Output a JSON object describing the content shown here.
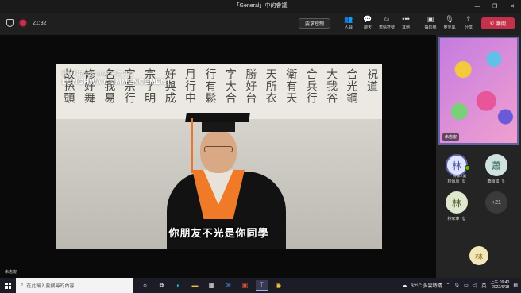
{
  "window": {
    "title": "「General」中的會議",
    "minimize": "—",
    "maximize": "❐",
    "close": "✕"
  },
  "toolbar": {
    "timer": "21:32",
    "request_control": "要求控制",
    "left_items": [
      {
        "label": "人員",
        "icon": "people-icon",
        "glyph": "👥"
      },
      {
        "label": "聊天",
        "icon": "chat-icon",
        "glyph": "💬"
      },
      {
        "label": "表情符號",
        "icon": "reaction-icon",
        "glyph": "☺"
      },
      {
        "label": "其他",
        "icon": "more-icon",
        "glyph": "•••"
      }
    ],
    "right_items": [
      {
        "label": "攝影機",
        "icon": "camera-off-icon",
        "glyph": "▣"
      },
      {
        "label": "麥克風",
        "icon": "mic-off-icon",
        "glyph": "🎙"
      },
      {
        "label": "分享",
        "icon": "share-icon",
        "glyph": "⇪"
      }
    ],
    "leave": "離開",
    "leave_color": "#c4314b"
  },
  "stage": {
    "logo_line1": "龍華科技大學 2022 畢業典禮",
    "logo_line2": "LUNGHWA COMMENCEMENT",
    "subtitle": "你朋友不光是你同學",
    "presenter_name": "朱志宏",
    "calligraphy": [
      "故孫頭",
      "修好舞",
      "名我易",
      "字宗行",
      "宗字明",
      "好與成",
      "月行中",
      "行有鬆",
      "字大合",
      "勝好台",
      "天所衣",
      "衛有天",
      "合兵行",
      "大我谷",
      "合光鋼",
      "祝道"
    ]
  },
  "sidebar": {
    "self_name": "朱志宏",
    "participants": [
      {
        "name": "林佩周",
        "initial": "林",
        "bg": "#dfe5ff",
        "fg": "#4a4f9a",
        "tag": "外部人員"
      },
      {
        "name": "蕭穎如",
        "initial": "蕭",
        "bg": "#cfe3de",
        "fg": "#2f5f55"
      },
      {
        "name": "林家瑋",
        "initial": "林",
        "bg": "#dfe8cf",
        "fg": "#4a5f2a"
      }
    ],
    "more_count": "+21",
    "bottom_initial": "林"
  },
  "taskbar": {
    "search_placeholder": "在此輸入要搜尋的內容",
    "weather": "32°C 多雲時晴",
    "ime": "英",
    "time": "上午 09:40",
    "date": "2022/6/18"
  }
}
